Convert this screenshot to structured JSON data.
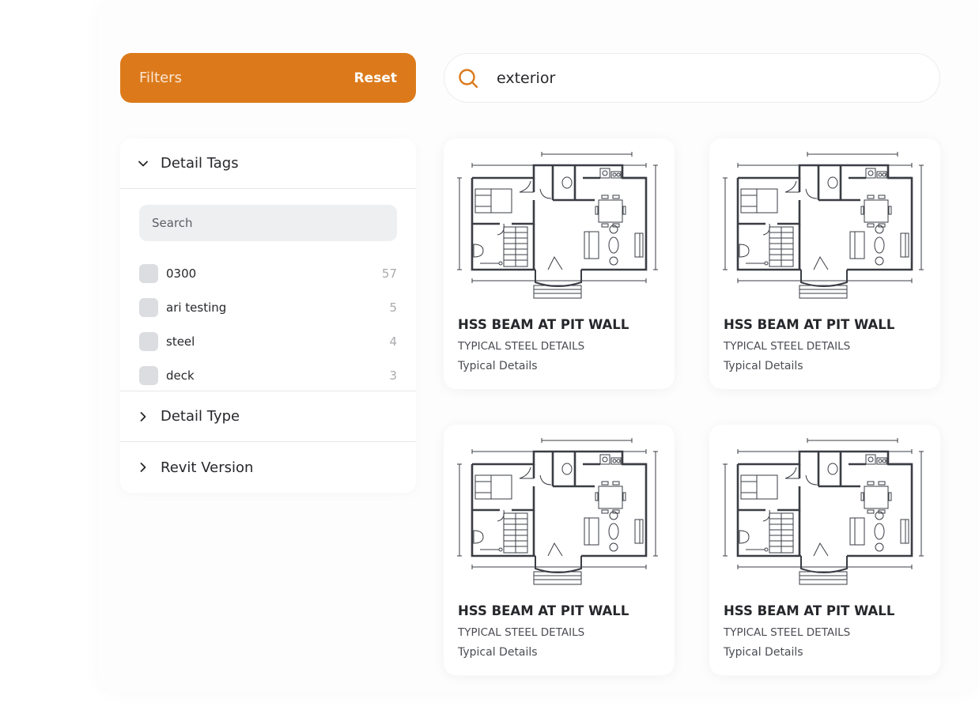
{
  "colors": {
    "accent": "#dc7a1b",
    "text": "#26272b",
    "muted": "#a9aaad"
  },
  "filters": {
    "title": "Filters",
    "reset_label": "Reset"
  },
  "search": {
    "value": "exterior",
    "icon": "search-icon"
  },
  "sidebar": {
    "sections": [
      {
        "label": "Detail Tags",
        "expanded": true,
        "icon": "chevron-down-icon"
      },
      {
        "label": "Detail Type",
        "expanded": false,
        "icon": "chevron-right-icon"
      },
      {
        "label": "Revit Version",
        "expanded": false,
        "icon": "chevron-right-icon"
      }
    ],
    "tag_search_placeholder": "Search",
    "tags": [
      {
        "label": "0300",
        "count": "57",
        "checked": false
      },
      {
        "label": "ari testing",
        "count": "5",
        "checked": false
      },
      {
        "label": "steel",
        "count": "4",
        "checked": false
      },
      {
        "label": "deck",
        "count": "3",
        "checked": false
      }
    ]
  },
  "cards": [
    {
      "title": "HSS BEAM AT PIT WALL",
      "category": "TYPICAL STEEL DETAILS",
      "subcategory": "Typical Details",
      "thumbnail": "floor-plan"
    },
    {
      "title": "HSS BEAM AT PIT WALL",
      "category": "TYPICAL STEEL DETAILS",
      "subcategory": "Typical Details",
      "thumbnail": "floor-plan"
    },
    {
      "title": "HSS BEAM AT PIT WALL",
      "category": "TYPICAL STEEL DETAILS",
      "subcategory": "Typical Details",
      "thumbnail": "floor-plan"
    },
    {
      "title": "HSS BEAM AT PIT WALL",
      "category": "TYPICAL STEEL DETAILS",
      "subcategory": "Typical Details",
      "thumbnail": "floor-plan"
    }
  ]
}
